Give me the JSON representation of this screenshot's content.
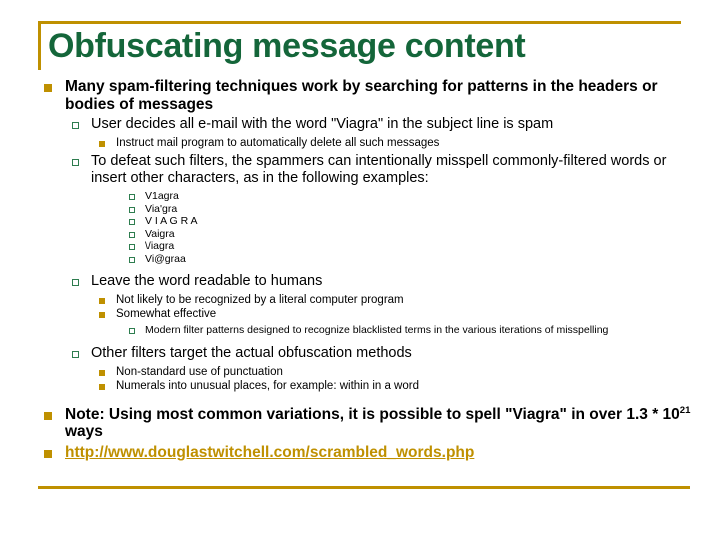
{
  "slide": {
    "title": "Obfuscating message content",
    "accent_color": "#BF9000",
    "title_color": "#14663A",
    "bullet_level2_color": "#2E7D4F",
    "background_color": "#FFFFFF"
  },
  "bullets": {
    "b1": "Many spam-filtering techniques work by searching for patterns in the headers or bodies of messages",
    "b2": "User decides all e-mail with the word \"Viagra\" in the subject line is spam",
    "b3": "Instruct mail program to automatically delete all such messages",
    "b4": "To defeat such filters, the spammers can intentionally misspell commonly-filtered words or insert other characters, as in the following examples:",
    "ex1": "V1agra",
    "ex2": "Via'gra",
    "ex3": "V I A G R A",
    "ex4": "Vaigra",
    "ex5": "\\/iagra",
    "ex6": "Vi@graa",
    "b5": "Leave the word readable to humans",
    "b6": "Not likely to be recognized by a literal computer program",
    "b7": "Somewhat effective",
    "b8": "Modern filter patterns designed to recognize blacklisted terms in the various iterations of misspelling",
    "b9": "Other filters target the actual obfuscation methods",
    "b10": "Non-standard use of punctuation",
    "b11": "Numerals into unusual places, for example: within in a word",
    "note_pre": "Note: Using most common variations, it is possible to spell \"Viagra\" in over 1.3 * 10",
    "note_sup": "21",
    "note_post": " ways",
    "link": "http://www.douglastwitchell.com/scrambled_words.php"
  }
}
